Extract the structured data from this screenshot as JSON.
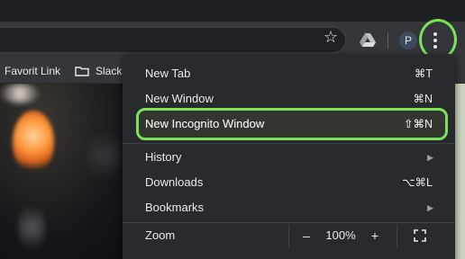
{
  "toolbar": {
    "avatar_letter": "P",
    "icons": [
      "star-icon",
      "google-drive-icon",
      "avatar",
      "more-vertical-icon"
    ]
  },
  "bookmarks_bar": {
    "items": [
      {
        "label": "Favorit Link",
        "type": "link"
      },
      {
        "label": "Slack",
        "type": "folder"
      }
    ]
  },
  "menu": {
    "items": [
      {
        "label": "New Tab",
        "shortcut": "⌘T"
      },
      {
        "label": "New Window",
        "shortcut": "⌘N"
      },
      {
        "label": "New Incognito Window",
        "shortcut": "⇧⌘N",
        "highlighted": true
      },
      {
        "label": "History",
        "submenu": true
      },
      {
        "label": "Downloads",
        "shortcut": "⌥⌘L"
      },
      {
        "label": "Bookmarks",
        "submenu": true
      }
    ],
    "zoom": {
      "label": "Zoom",
      "minus": "–",
      "value": "100%",
      "plus": "+"
    }
  },
  "colors": {
    "highlight": "#7be35a",
    "menu_bg": "#292a2d",
    "toolbar_bg": "#35363a"
  }
}
